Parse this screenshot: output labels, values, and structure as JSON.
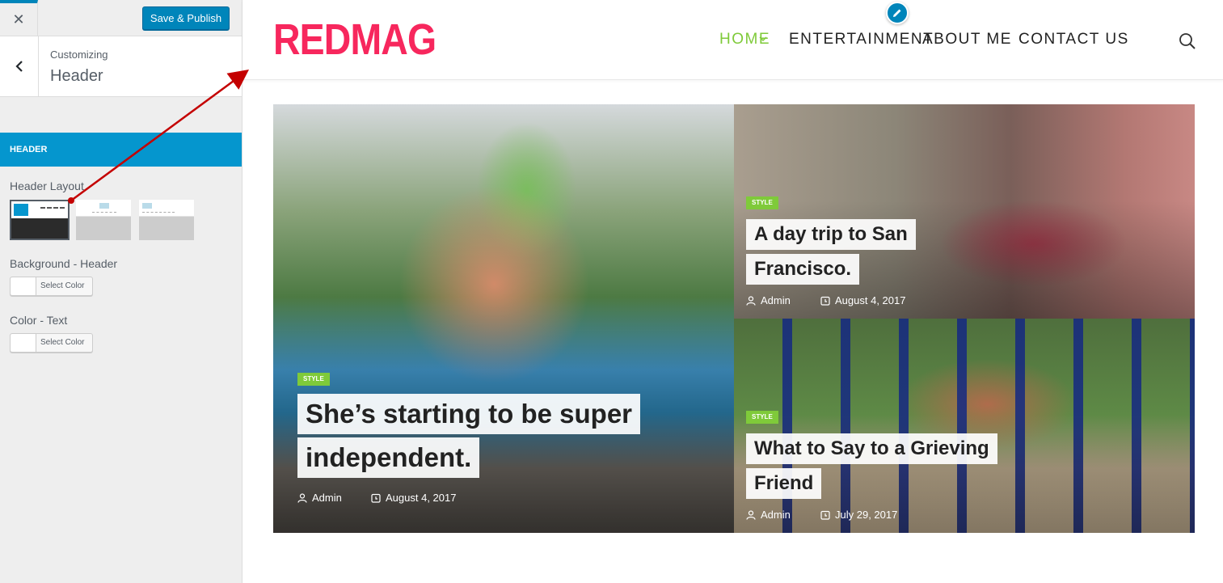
{
  "customizer": {
    "close_icon_char": "✕",
    "publish_label": "Save & Publish",
    "back_icon_char": "‹",
    "customizing_label": "Customizing",
    "section_title": "Header",
    "section_bar_label": "HEADER",
    "header_layout_label": "Header Layout",
    "bg_label": "Background - Header",
    "bg_button": "Select Color",
    "color_label": "Color - Text",
    "color_button": "Select Color",
    "accent": "#0596ce"
  },
  "site": {
    "logo": "REDMAG",
    "logo_color": "#f7275d",
    "accent": "#7fca3a",
    "nav": [
      {
        "label": "HOME",
        "active": true
      },
      {
        "label": "ENTERTAINMENT",
        "active": false
      },
      {
        "label": "ABOUT ME",
        "active": false
      },
      {
        "label": "CONTACT US",
        "active": false
      }
    ],
    "search_icon": "search-icon",
    "edit_icon": "pencil-icon"
  },
  "posts": [
    {
      "tag": "STYLE",
      "title_lines": [
        "She’s starting to be super",
        "independent."
      ],
      "author": "Admin",
      "date": "August 4, 2017"
    },
    {
      "tag": "STYLE",
      "title_lines": [
        "A day trip to San",
        "Francisco."
      ],
      "author": "Admin",
      "date": "August 4, 2017"
    },
    {
      "tag": "STYLE",
      "title_lines": [
        "What to Say to a Grieving",
        "Friend"
      ],
      "author": "Admin",
      "date": "July 29, 2017"
    }
  ]
}
